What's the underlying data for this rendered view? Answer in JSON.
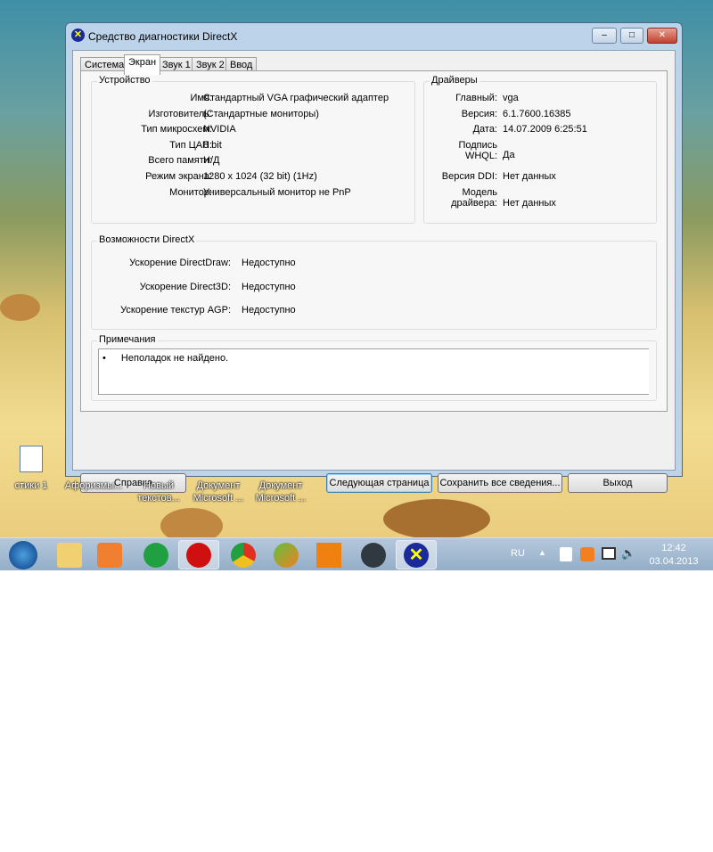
{
  "window": {
    "title": "Средство диагностики DirectX",
    "min": "–",
    "max": "□",
    "close": "✕"
  },
  "tabs": [
    "Система",
    "Экран",
    "Звук 1",
    "Звук 2",
    "Ввод"
  ],
  "device": {
    "title": "Устройство",
    "rows": [
      {
        "label": "Имя:",
        "value": "Стандартный VGA графический адаптер"
      },
      {
        "label": "Изготовитель:",
        "value": "(Стандартные мониторы)"
      },
      {
        "label": "Тип микросхем:",
        "value": "NVIDIA"
      },
      {
        "label": "Тип ЦАП:",
        "value": "8 bit"
      },
      {
        "label": "Всего памяти:",
        "value": "Н/Д"
      },
      {
        "label": "Режим экрана:",
        "value": "1280 x 1024 (32 bit) (1Hz)"
      },
      {
        "label": "Монитор:",
        "value": "Универсальный монитор не PnP"
      }
    ]
  },
  "drivers": {
    "title": "Драйверы",
    "main_label": "Главный:",
    "main": "vga",
    "version_label": "Версия:",
    "version": "6.1.7600.16385",
    "date_label": "Дата:",
    "date": "14.07.2009 6:25:51",
    "whql_label": "Подпись WHQL:",
    "whql": "Да",
    "ddi_label": "Версия DDI:",
    "ddi": "Нет данных",
    "model_label1": "Модель",
    "model_label2": "драйвера:",
    "model": "Нет данных"
  },
  "features": {
    "title": "Возможности DirectX",
    "rows": [
      {
        "label": "Ускорение DirectDraw:",
        "value": "Недоступно"
      },
      {
        "label": "Ускорение Direct3D:",
        "value": "Недоступно"
      },
      {
        "label": "Ускорение текстур AGP:",
        "value": "Недоступно"
      }
    ]
  },
  "notes": {
    "title": "Примечания",
    "items": [
      "Неполадок не найдено."
    ]
  },
  "buttons": {
    "help": "Справка",
    "next": "Следующая страница",
    "save": "Сохранить все сведения...",
    "exit": "Выход"
  },
  "desktop_icons": [
    {
      "l1": "стики 1",
      "l2": ""
    },
    {
      "l1": "Афоризмы...",
      "l2": ""
    },
    {
      "l1": "Новый",
      "l2": "текстов..."
    },
    {
      "l1": "Документ",
      "l2": "Microsoft ..."
    },
    {
      "l1": "Документ",
      "l2": "Microsoft ..."
    }
  ],
  "tray": {
    "lang": "RU",
    "time": "12:42",
    "date": "03.04.2013"
  }
}
